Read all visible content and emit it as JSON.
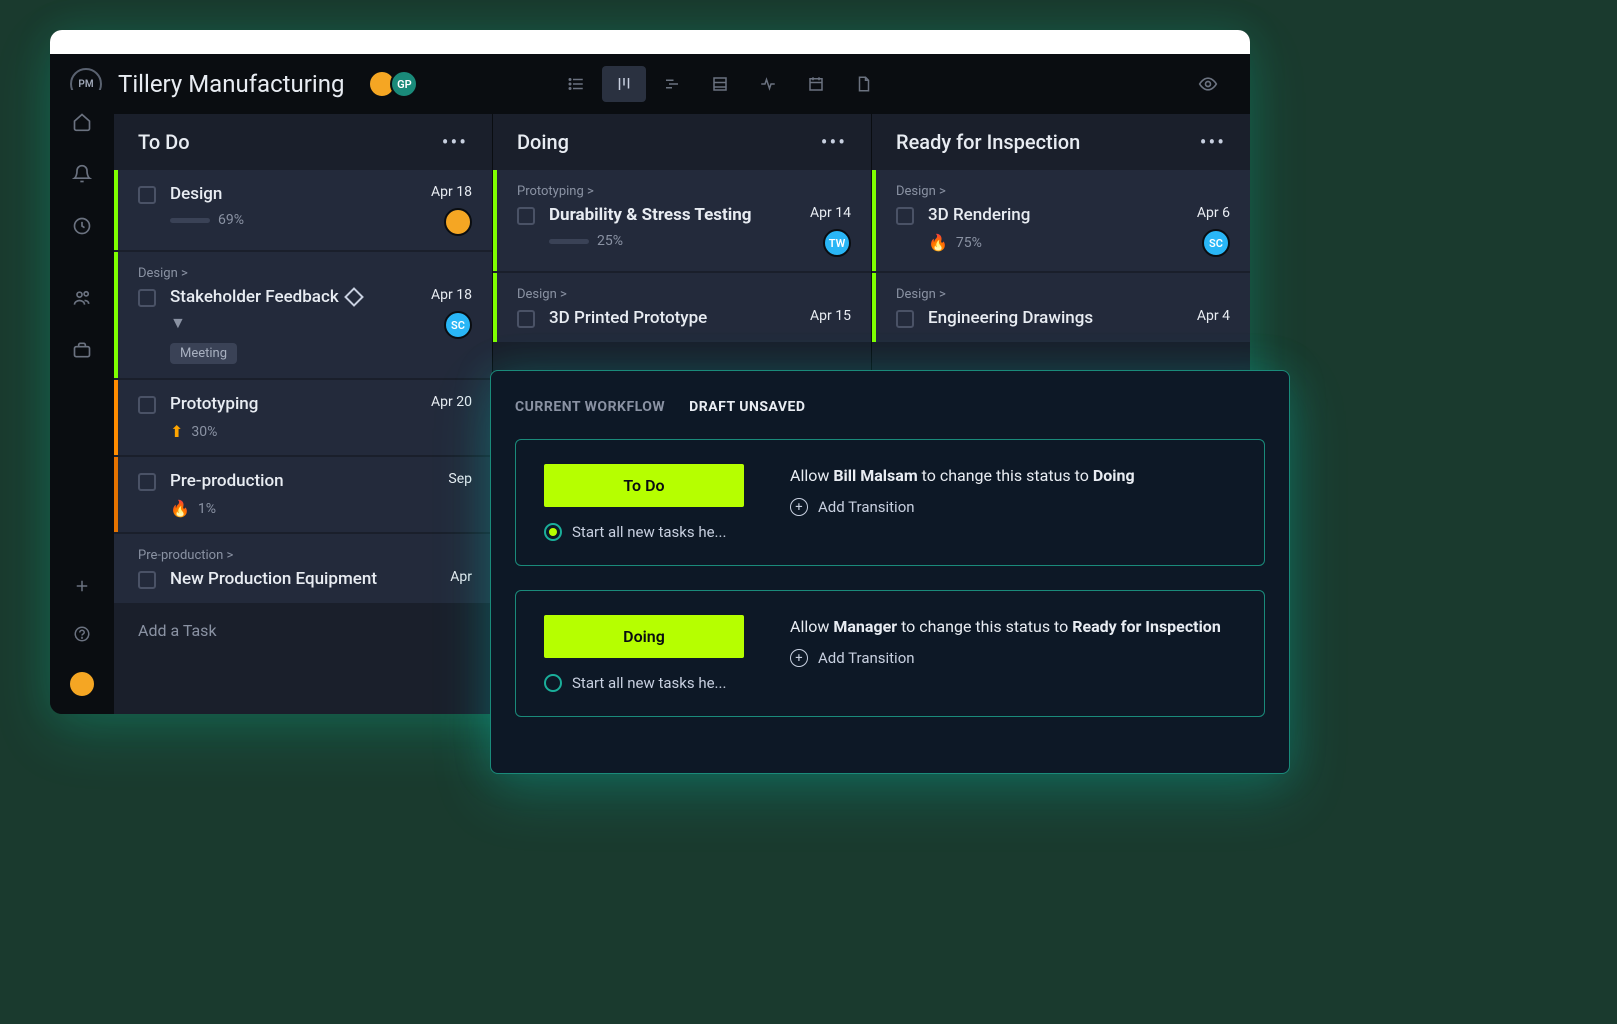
{
  "project": {
    "title": "Tillery Manufacturing",
    "logo_text": "PM"
  },
  "header_avatars": [
    {
      "initials": "",
      "bg": "#f5a623"
    },
    {
      "initials": "GP",
      "bg": "#1a8a7a"
    }
  ],
  "columns": [
    {
      "title": "To Do",
      "cards": [
        {
          "accent": "acc-green",
          "title": "Design",
          "pct": "69%",
          "date": "Apr 18",
          "avatar": {
            "bg": "#f5a623",
            "initials": ""
          },
          "has_progress": true
        },
        {
          "accent": "acc-green",
          "category": "Design >",
          "title": "Stakeholder Feedback",
          "has_diamond": true,
          "date": "Apr 18",
          "avatar": {
            "bg": "#29b6f6",
            "initials": "SC"
          },
          "has_chev": true,
          "tag": "Meeting"
        },
        {
          "accent": "acc-orange",
          "title": "Prototyping",
          "pct": "30%",
          "date": "Apr 20",
          "icon": "arrow-up",
          "has_progress": false
        },
        {
          "accent": "acc-dkorange",
          "title": "Pre-production",
          "pct": "1%",
          "date": "Sep",
          "icon": "fire"
        },
        {
          "accent": "",
          "category": "Pre-production >",
          "title": "New Production Equipment",
          "date": "Apr"
        }
      ],
      "add_label": "Add a Task"
    },
    {
      "title": "Doing",
      "cards": [
        {
          "accent": "acc-green",
          "category": "Prototyping >",
          "title": "Durability & Stress Testing",
          "bold": true,
          "pct": "25%",
          "date": "Apr 14",
          "avatar": {
            "bg": "#29b6f6",
            "initials": "TW"
          },
          "has_progress": true
        },
        {
          "accent": "acc-green",
          "category": "Design >",
          "title": "3D Printed Prototype",
          "date": "Apr 15"
        }
      ]
    },
    {
      "title": "Ready for Inspection",
      "cards": [
        {
          "accent": "acc-green",
          "category": "Design >",
          "title": "3D Rendering",
          "pct": "75%",
          "date": "Apr 6",
          "avatar": {
            "bg": "#29b6f6",
            "initials": "SC"
          },
          "icon": "fire"
        },
        {
          "accent": "acc-green",
          "category": "Design >",
          "title": "Engineering Drawings",
          "date": "Apr 4"
        }
      ]
    }
  ],
  "workflow": {
    "tabs": {
      "current": "CURRENT WORKFLOW",
      "draft": "DRAFT UNSAVED"
    },
    "blocks": [
      {
        "status": "To Do",
        "radio_label": "Start all new tasks he...",
        "radio_checked": true,
        "allow_prefix": "Allow ",
        "actor": "Bill Malsam",
        "mid": " to change this status to ",
        "target": "Doing",
        "add_label": "Add Transition"
      },
      {
        "status": "Doing",
        "radio_label": "Start all new tasks he...",
        "radio_checked": false,
        "allow_prefix": "Allow ",
        "actor": "Manager",
        "mid": " to change this status to ",
        "target": "Ready for Inspection",
        "add_label": "Add Transition"
      }
    ]
  }
}
